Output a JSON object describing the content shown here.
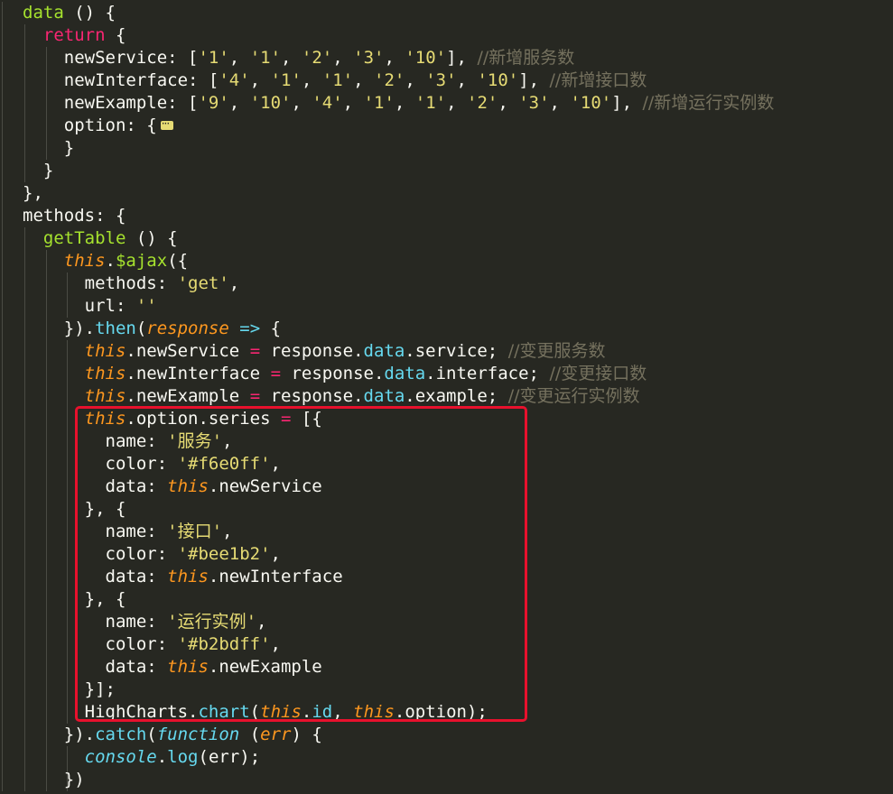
{
  "lines": [
    [
      {
        "t": "data",
        "c": "kw-green"
      },
      {
        "t": " () {",
        "c": "plain"
      }
    ],
    [
      {
        "t": "  ",
        "c": "plain"
      },
      {
        "t": "return",
        "c": "kw-red"
      },
      {
        "t": " {",
        "c": "plain"
      }
    ],
    [
      {
        "t": "    newService: [",
        "c": "plain"
      },
      {
        "t": "'1'",
        "c": "str"
      },
      {
        "t": ", ",
        "c": "plain"
      },
      {
        "t": "'1'",
        "c": "str"
      },
      {
        "t": ", ",
        "c": "plain"
      },
      {
        "t": "'2'",
        "c": "str"
      },
      {
        "t": ", ",
        "c": "plain"
      },
      {
        "t": "'3'",
        "c": "str"
      },
      {
        "t": ", ",
        "c": "plain"
      },
      {
        "t": "'10'",
        "c": "str"
      },
      {
        "t": "], ",
        "c": "plain"
      },
      {
        "t": "//新增服务数",
        "c": "cmt"
      }
    ],
    [
      {
        "t": "    newInterface: [",
        "c": "plain"
      },
      {
        "t": "'4'",
        "c": "str"
      },
      {
        "t": ", ",
        "c": "plain"
      },
      {
        "t": "'1'",
        "c": "str"
      },
      {
        "t": ", ",
        "c": "plain"
      },
      {
        "t": "'1'",
        "c": "str"
      },
      {
        "t": ", ",
        "c": "plain"
      },
      {
        "t": "'2'",
        "c": "str"
      },
      {
        "t": ", ",
        "c": "plain"
      },
      {
        "t": "'3'",
        "c": "str"
      },
      {
        "t": ", ",
        "c": "plain"
      },
      {
        "t": "'10'",
        "c": "str"
      },
      {
        "t": "], ",
        "c": "plain"
      },
      {
        "t": "//新增接口数",
        "c": "cmt"
      }
    ],
    [
      {
        "t": "    newExample: [",
        "c": "plain"
      },
      {
        "t": "'9'",
        "c": "str"
      },
      {
        "t": ", ",
        "c": "plain"
      },
      {
        "t": "'10'",
        "c": "str"
      },
      {
        "t": ", ",
        "c": "plain"
      },
      {
        "t": "'4'",
        "c": "str"
      },
      {
        "t": ", ",
        "c": "plain"
      },
      {
        "t": "'1'",
        "c": "str"
      },
      {
        "t": ", ",
        "c": "plain"
      },
      {
        "t": "'1'",
        "c": "str"
      },
      {
        "t": ", ",
        "c": "plain"
      },
      {
        "t": "'2'",
        "c": "str"
      },
      {
        "t": ", ",
        "c": "plain"
      },
      {
        "t": "'3'",
        "c": "str"
      },
      {
        "t": ", ",
        "c": "plain"
      },
      {
        "t": "'10'",
        "c": "str"
      },
      {
        "t": "], ",
        "c": "plain"
      },
      {
        "t": "//新增运行实例数",
        "c": "cmt"
      }
    ],
    [
      {
        "t": "    option: {",
        "c": "plain"
      },
      {
        "t": "",
        "c": "fold"
      }
    ],
    [
      {
        "t": "    }",
        "c": "plain"
      }
    ],
    [
      {
        "t": "  }",
        "c": "plain"
      }
    ],
    [
      {
        "t": "},",
        "c": "plain"
      }
    ],
    [
      {
        "t": "methods: {",
        "c": "plain"
      }
    ],
    [
      {
        "t": "  ",
        "c": "plain"
      },
      {
        "t": "getTable",
        "c": "kw-green"
      },
      {
        "t": " () {",
        "c": "plain"
      }
    ],
    [
      {
        "t": "    ",
        "c": "plain"
      },
      {
        "t": "this",
        "c": "kw-this"
      },
      {
        "t": ".",
        "c": "plain"
      },
      {
        "t": "$ajax",
        "c": "kw-green"
      },
      {
        "t": "({",
        "c": "plain"
      }
    ],
    [
      {
        "t": "      methods: ",
        "c": "plain"
      },
      {
        "t": "'get'",
        "c": "str"
      },
      {
        "t": ",",
        "c": "plain"
      }
    ],
    [
      {
        "t": "      url: ",
        "c": "plain"
      },
      {
        "t": "''",
        "c": "str"
      }
    ],
    [
      {
        "t": "    }).",
        "c": "plain"
      },
      {
        "t": "then",
        "c": "kw-blue"
      },
      {
        "t": "(",
        "c": "plain"
      },
      {
        "t": "response",
        "c": "param"
      },
      {
        "t": " ",
        "c": "plain"
      },
      {
        "t": "=>",
        "c": "kw-blue"
      },
      {
        "t": " {",
        "c": "plain"
      }
    ],
    [
      {
        "t": "      ",
        "c": "plain"
      },
      {
        "t": "this",
        "c": "kw-this"
      },
      {
        "t": ".newService ",
        "c": "plain"
      },
      {
        "t": "=",
        "c": "kw-red"
      },
      {
        "t": " response.",
        "c": "plain"
      },
      {
        "t": "data",
        "c": "kw-blue"
      },
      {
        "t": ".service; ",
        "c": "plain"
      },
      {
        "t": "//变更服务数",
        "c": "cmt"
      }
    ],
    [
      {
        "t": "      ",
        "c": "plain"
      },
      {
        "t": "this",
        "c": "kw-this"
      },
      {
        "t": ".newInterface ",
        "c": "plain"
      },
      {
        "t": "=",
        "c": "kw-red"
      },
      {
        "t": " response.",
        "c": "plain"
      },
      {
        "t": "data",
        "c": "kw-blue"
      },
      {
        "t": ".interface; ",
        "c": "plain"
      },
      {
        "t": "//变更接口数",
        "c": "cmt"
      }
    ],
    [
      {
        "t": "      ",
        "c": "plain"
      },
      {
        "t": "this",
        "c": "kw-this"
      },
      {
        "t": ".newExample ",
        "c": "plain"
      },
      {
        "t": "=",
        "c": "kw-red"
      },
      {
        "t": " response.",
        "c": "plain"
      },
      {
        "t": "data",
        "c": "kw-blue"
      },
      {
        "t": ".example; ",
        "c": "plain"
      },
      {
        "t": "//变更运行实例数",
        "c": "cmt"
      }
    ],
    [
      {
        "t": "      ",
        "c": "plain"
      },
      {
        "t": "this",
        "c": "kw-this"
      },
      {
        "t": ".option.series ",
        "c": "plain"
      },
      {
        "t": "=",
        "c": "kw-red"
      },
      {
        "t": " [{",
        "c": "plain"
      }
    ],
    [
      {
        "t": "        name: ",
        "c": "plain"
      },
      {
        "t": "'服务'",
        "c": "str"
      },
      {
        "t": ",",
        "c": "plain"
      }
    ],
    [
      {
        "t": "        color: ",
        "c": "plain"
      },
      {
        "t": "'#f6e0ff'",
        "c": "str"
      },
      {
        "t": ",",
        "c": "plain"
      }
    ],
    [
      {
        "t": "        data: ",
        "c": "plain"
      },
      {
        "t": "this",
        "c": "kw-this"
      },
      {
        "t": ".newService",
        "c": "plain"
      }
    ],
    [
      {
        "t": "      }, {",
        "c": "plain"
      }
    ],
    [
      {
        "t": "        name: ",
        "c": "plain"
      },
      {
        "t": "'接口'",
        "c": "str"
      },
      {
        "t": ",",
        "c": "plain"
      }
    ],
    [
      {
        "t": "        color: ",
        "c": "plain"
      },
      {
        "t": "'#bee1b2'",
        "c": "str"
      },
      {
        "t": ",",
        "c": "plain"
      }
    ],
    [
      {
        "t": "        data: ",
        "c": "plain"
      },
      {
        "t": "this",
        "c": "kw-this"
      },
      {
        "t": ".newInterface",
        "c": "plain"
      }
    ],
    [
      {
        "t": "      }, {",
        "c": "plain"
      }
    ],
    [
      {
        "t": "        name: ",
        "c": "plain"
      },
      {
        "t": "'运行实例'",
        "c": "str"
      },
      {
        "t": ",",
        "c": "plain"
      }
    ],
    [
      {
        "t": "        color: ",
        "c": "plain"
      },
      {
        "t": "'#b2bdff'",
        "c": "str"
      },
      {
        "t": ",",
        "c": "plain"
      }
    ],
    [
      {
        "t": "        data: ",
        "c": "plain"
      },
      {
        "t": "this",
        "c": "kw-this"
      },
      {
        "t": ".newExample",
        "c": "plain"
      }
    ],
    [
      {
        "t": "      }];",
        "c": "plain"
      }
    ],
    [
      {
        "t": "      HighCharts.",
        "c": "plain"
      },
      {
        "t": "chart",
        "c": "kw-blue"
      },
      {
        "t": "(",
        "c": "plain"
      },
      {
        "t": "this",
        "c": "kw-this"
      },
      {
        "t": ".",
        "c": "plain"
      },
      {
        "t": "id",
        "c": "kw-blue"
      },
      {
        "t": ", ",
        "c": "plain"
      },
      {
        "t": "this",
        "c": "kw-this"
      },
      {
        "t": ".option);",
        "c": "plain"
      }
    ],
    [
      {
        "t": "    }).",
        "c": "plain"
      },
      {
        "t": "catch",
        "c": "kw-blue"
      },
      {
        "t": "(",
        "c": "plain"
      },
      {
        "t": "function",
        "c": "kw-blue-i"
      },
      {
        "t": " (",
        "c": "plain"
      },
      {
        "t": "err",
        "c": "param"
      },
      {
        "t": ") {",
        "c": "plain"
      }
    ],
    [
      {
        "t": "      ",
        "c": "plain"
      },
      {
        "t": "console",
        "c": "kw-blue-i"
      },
      {
        "t": ".",
        "c": "plain"
      },
      {
        "t": "log",
        "c": "kw-blue"
      },
      {
        "t": "(err);",
        "c": "plain"
      }
    ],
    [
      {
        "t": "    })",
        "c": "plain"
      }
    ],
    [
      {
        "t": "  }",
        "c": "plain"
      }
    ]
  ],
  "theme": {
    "background": "#272822",
    "highlight_border": "#e8112d"
  }
}
